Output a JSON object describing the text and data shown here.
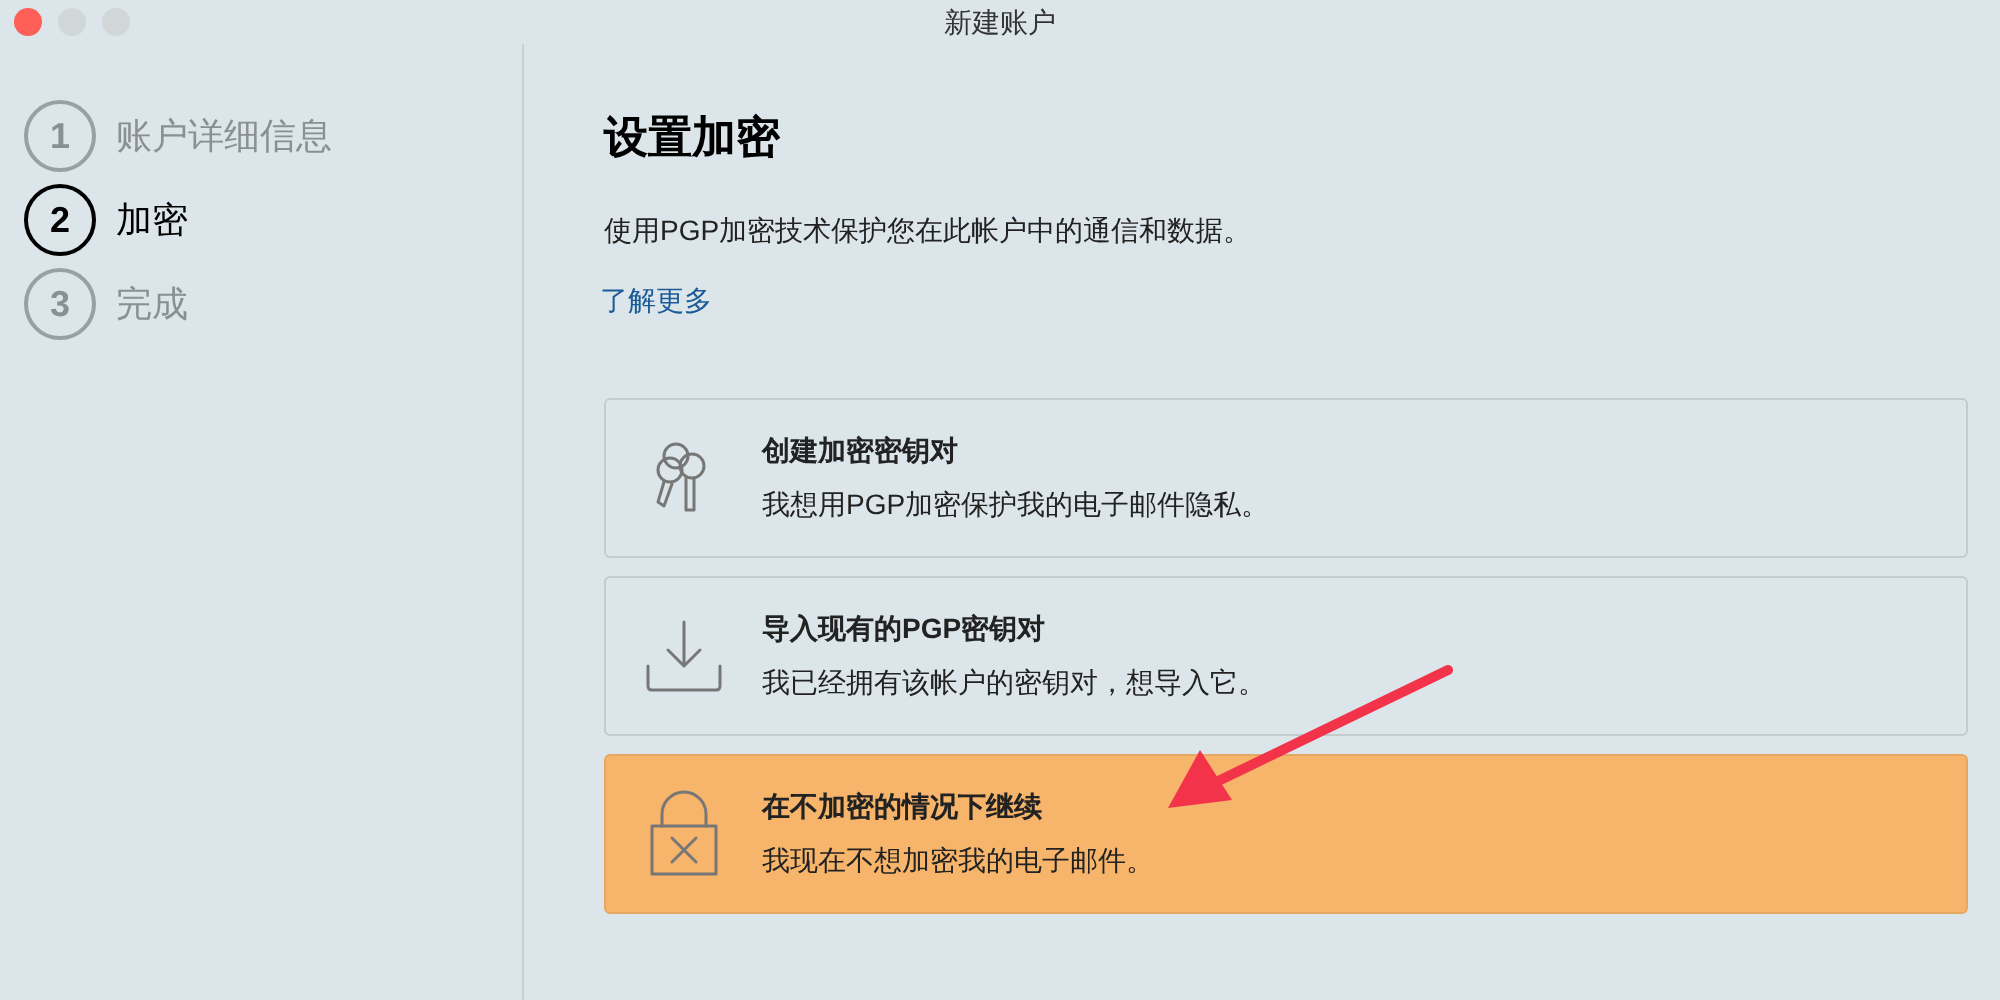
{
  "window": {
    "title": "新建账户"
  },
  "steps": [
    {
      "number": "1",
      "label": "账户详细信息",
      "selected": false
    },
    {
      "number": "2",
      "label": "加密",
      "selected": true
    },
    {
      "number": "3",
      "label": "完成",
      "selected": false
    }
  ],
  "heading": "设置加密",
  "description": "使用PGP加密技术保护您在此帐户中的通信和数据。",
  "link": "了解更多",
  "options": [
    {
      "kind": "keys",
      "title": "创建加密密钥对",
      "subtitle": "我想用PGP加密保护我的电子邮件隐私。",
      "selected": false
    },
    {
      "kind": "import",
      "title": "导入现有的PGP密钥对",
      "subtitle": "我已经拥有该帐户的密钥对，想导入它。",
      "selected": false
    },
    {
      "kind": "nolock",
      "title": "在不加密的情况下继续",
      "subtitle": "我现在不想加密我的电子邮件。",
      "selected": true
    }
  ]
}
